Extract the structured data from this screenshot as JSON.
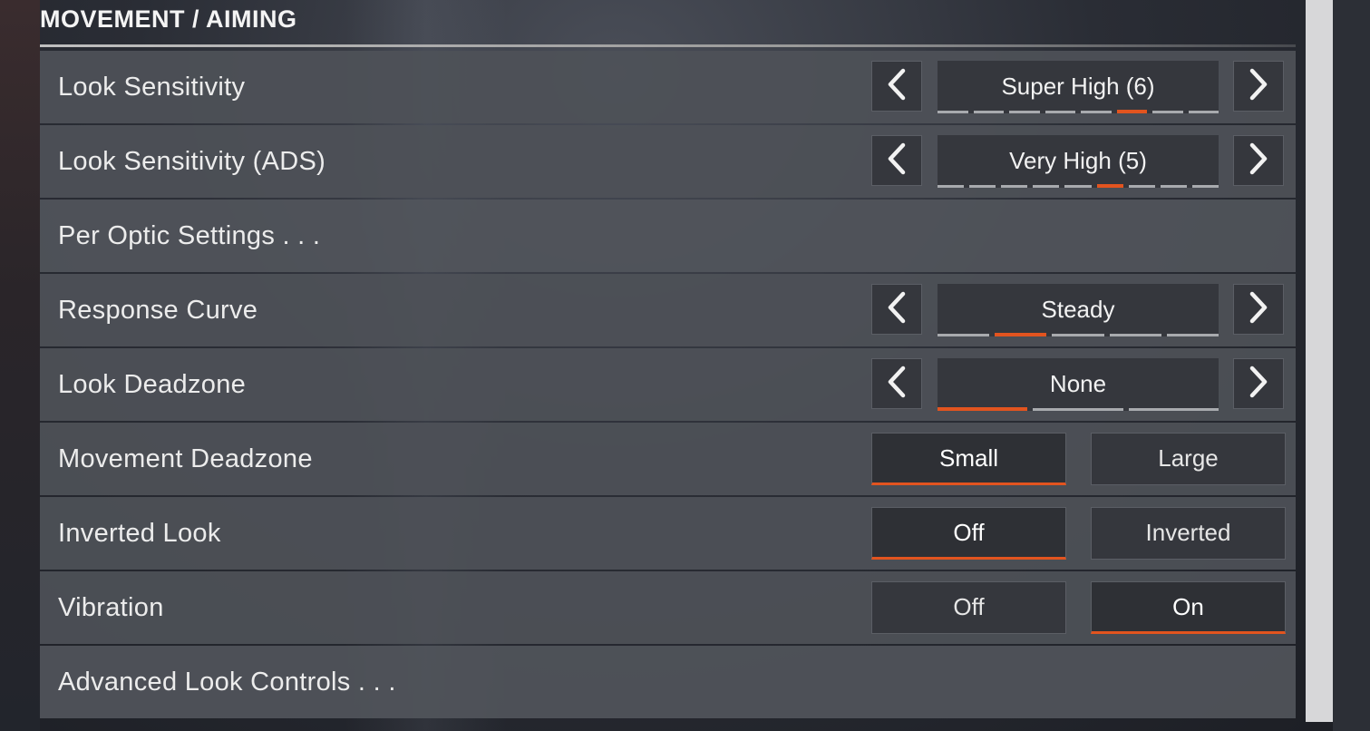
{
  "section": {
    "title": "MOVEMENT / AIMING"
  },
  "colors": {
    "accent": "#e2541f",
    "panel": "#4e5158",
    "control": "#35373d"
  },
  "rows": [
    {
      "label": "Look Sensitivity",
      "type": "stepper",
      "value": "Super High  (6)",
      "ticks": 8,
      "selected_index": 5
    },
    {
      "label": "Look Sensitivity  (ADS)",
      "type": "stepper",
      "value": "Very High  (5)",
      "ticks": 9,
      "selected_index": 5
    },
    {
      "label": "Per Optic Settings . . .",
      "type": "link"
    },
    {
      "label": "Response Curve",
      "type": "stepper",
      "value": "Steady",
      "ticks": 5,
      "selected_index": 1
    },
    {
      "label": "Look Deadzone",
      "type": "stepper",
      "value": "None",
      "ticks": 3,
      "selected_index": 0
    },
    {
      "label": "Movement Deadzone",
      "type": "toggle",
      "options": [
        "Small",
        "Large"
      ],
      "selected_index": 0
    },
    {
      "label": "Inverted Look",
      "type": "toggle",
      "options": [
        "Off",
        "Inverted"
      ],
      "selected_index": 0
    },
    {
      "label": "Vibration",
      "type": "toggle",
      "options": [
        "Off",
        "On"
      ],
      "selected_index": 1
    },
    {
      "label": "Advanced Look Controls . . .",
      "type": "link"
    }
  ],
  "icons": {
    "prev": "chevron-left-icon",
    "next": "chevron-right-icon"
  }
}
